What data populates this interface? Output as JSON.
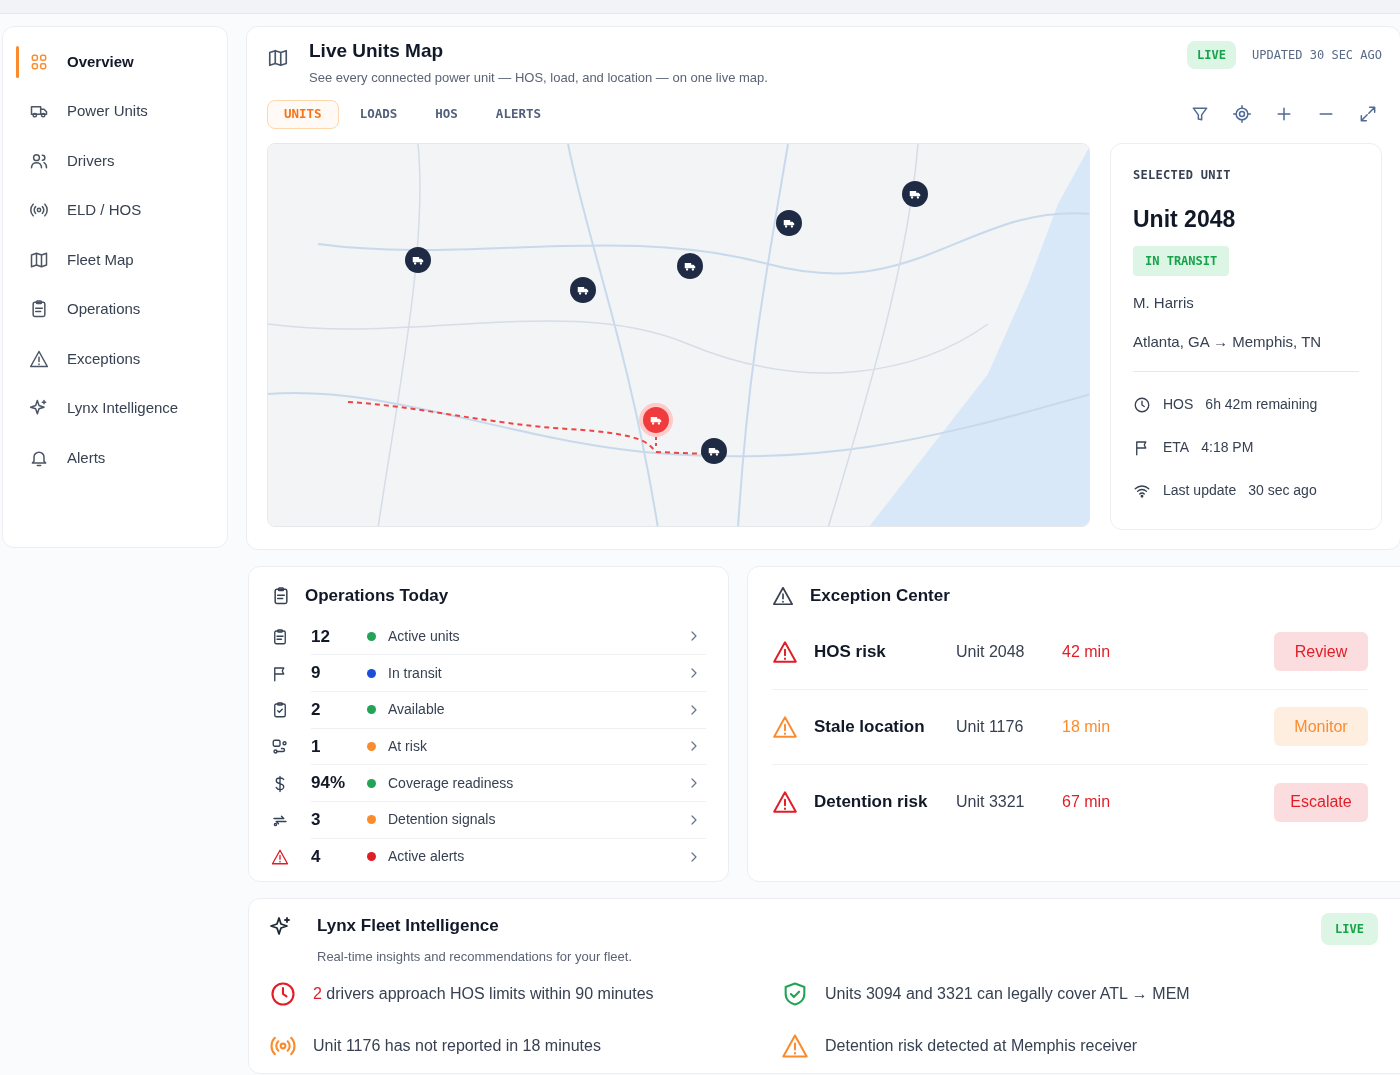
{
  "sidebar": {
    "items": [
      {
        "label": "Overview",
        "selected": true
      },
      {
        "label": "Power Units",
        "selected": false
      },
      {
        "label": "Drivers",
        "selected": false
      },
      {
        "label": "ELD / HOS",
        "selected": false
      },
      {
        "label": "Fleet Map",
        "selected": false
      },
      {
        "label": "Operations",
        "selected": false
      },
      {
        "label": "Exceptions",
        "selected": false
      },
      {
        "label": "Lynx Intelligence",
        "selected": false
      },
      {
        "label": "Alerts",
        "selected": false
      }
    ]
  },
  "map_panel": {
    "title": "Live Units Map",
    "subtitle": "See every connected power unit — HOS, load, and location — on one live map.",
    "badge": "LIVE",
    "updated": "UPDATED 30 SEC AGO",
    "tabs": [
      {
        "label": "UNITS",
        "selected": true
      },
      {
        "label": "LOADS",
        "selected": false
      },
      {
        "label": "HOS",
        "selected": false
      },
      {
        "label": "ALERTS",
        "selected": false
      }
    ],
    "selected_unit": {
      "heading": "SELECTED UNIT",
      "name": "Unit 2048",
      "status": "IN TRANSIT",
      "driver": "M. Harris",
      "route": "Atlanta, GA → Memphis, TN",
      "details": [
        {
          "label": "HOS",
          "value": "6h 42m remaining"
        },
        {
          "label": "ETA",
          "value": "4:18 PM"
        },
        {
          "label": "Last update",
          "value": "30 sec ago"
        }
      ]
    }
  },
  "operations": {
    "title": "Operations Today",
    "rows": [
      {
        "value": "12",
        "label": "Active units",
        "color": "#22a355"
      },
      {
        "value": "9",
        "label": "In transit",
        "color": "#1d4ed8"
      },
      {
        "value": "2",
        "label": "Available",
        "color": "#22a355"
      },
      {
        "value": "1",
        "label": "At risk",
        "color": "#fb8c2e"
      },
      {
        "value": "94%",
        "label": "Coverage readiness",
        "color": "#22a355"
      },
      {
        "value": "3",
        "label": "Detention signals",
        "color": "#fb8c2e"
      },
      {
        "value": "4",
        "label": "Active alerts",
        "color": "#e11d26"
      }
    ]
  },
  "exceptions": {
    "title": "Exception Center",
    "rows": [
      {
        "color": "#e11d26",
        "name": "HOS risk",
        "unit": "Unit 2048",
        "time": "42 min",
        "action": "Review"
      },
      {
        "color": "#fb8c2e",
        "name": "Stale location",
        "unit": "Unit 1176",
        "time": "18 min",
        "action": "Monitor"
      },
      {
        "color": "#e11d26",
        "name": "Detention risk",
        "unit": "Unit 3321",
        "time": "67 min",
        "action": "Escalate"
      }
    ]
  },
  "intelligence": {
    "title": "Lynx Fleet Intelligence",
    "subtitle": "Real-time insights and recommendations for your fleet.",
    "badge": "LIVE",
    "insights": [
      {
        "highlight": "2",
        "text": "drivers approach HOS limits within 90 minutes"
      },
      {
        "text": "Units 3094 and 3321 can legally cover ATL → MEM"
      },
      {
        "text": "Unit 1176 has not reported in 18 minutes"
      },
      {
        "text": "Detention risk detected at Memphis receiver"
      }
    ]
  }
}
